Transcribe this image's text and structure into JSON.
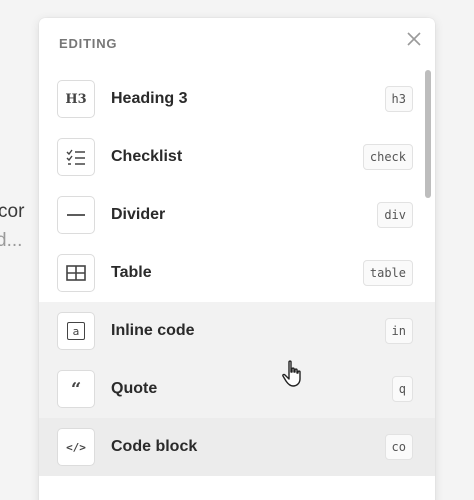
{
  "editor": {
    "line1": "cor",
    "line2": "d..."
  },
  "popup": {
    "section_title": "EDITING",
    "close_icon": "close-icon",
    "items": [
      {
        "icon": "heading-3-icon",
        "icon_text": "H3",
        "label": "Heading 3",
        "shortcut": "h3"
      },
      {
        "icon": "checklist-icon",
        "label": "Checklist",
        "shortcut": "check"
      },
      {
        "icon": "divider-icon",
        "label": "Divider",
        "shortcut": "div"
      },
      {
        "icon": "table-icon",
        "label": "Table",
        "shortcut": "table"
      },
      {
        "icon": "inline-code-icon",
        "icon_text": "a",
        "label": "Inline code",
        "shortcut": "in"
      },
      {
        "icon": "quote-icon",
        "icon_text": "66",
        "label": "Quote",
        "shortcut": "q"
      },
      {
        "icon": "code-block-icon",
        "icon_text": "</>",
        "label": "Code block",
        "shortcut": "co"
      }
    ]
  },
  "colors": {
    "popup_bg": "#ffffff",
    "hover_row_bg": "#f2f2f2",
    "label_text": "#2a2a2a",
    "section_title_text": "#777777"
  }
}
